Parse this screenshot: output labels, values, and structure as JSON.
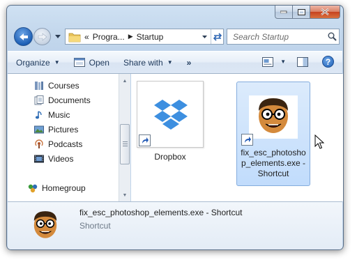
{
  "navigation": {
    "back_tooltip": "Back",
    "address": {
      "overflow": "«",
      "segments": [
        "Progra...",
        "Startup"
      ]
    },
    "search": {
      "placeholder": "Search Startup"
    }
  },
  "toolbar": {
    "organize": "Organize",
    "open": "Open",
    "share_with": "Share with",
    "more": "»"
  },
  "nav_pane": {
    "items": [
      {
        "label": "Courses",
        "icon": "library-icon"
      },
      {
        "label": "Documents",
        "icon": "documents-icon"
      },
      {
        "label": "Music",
        "icon": "music-icon"
      },
      {
        "label": "Pictures",
        "icon": "pictures-icon"
      },
      {
        "label": "Podcasts",
        "icon": "podcasts-icon"
      },
      {
        "label": "Videos",
        "icon": "videos-icon"
      }
    ],
    "homegroup": "Homegroup"
  },
  "files": [
    {
      "label": "Dropbox",
      "icon": "dropbox-icon",
      "shortcut": true,
      "selected": false
    },
    {
      "label": "fix_esc_photoshop_elements.exe - Shortcut",
      "label_lines": [
        "fix_esc_photosho",
        "p_elements.exe -",
        "Shortcut"
      ],
      "icon": "cartoon-face-icon",
      "shortcut": true,
      "selected": true
    }
  ],
  "details": {
    "name": "fix_esc_photoshop_elements.exe - Shortcut",
    "type": "Shortcut"
  },
  "colors": {
    "selection": "#c1dcfc",
    "dropbox_blue": "#3d8fe0",
    "frame": "#c3d7ec"
  }
}
